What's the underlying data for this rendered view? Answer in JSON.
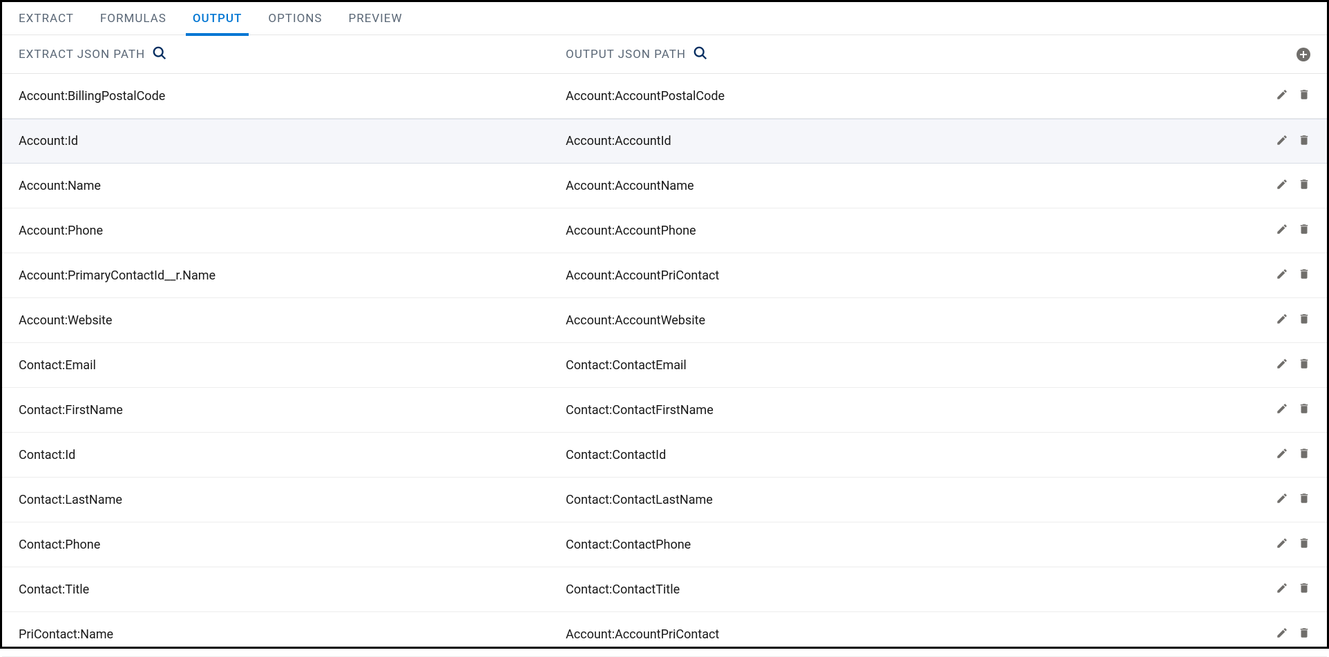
{
  "tabs": [
    {
      "label": "EXTRACT"
    },
    {
      "label": "FORMULAS"
    },
    {
      "label": "OUTPUT"
    },
    {
      "label": "OPTIONS"
    },
    {
      "label": "PREVIEW"
    }
  ],
  "activeTabIndex": 2,
  "headers": {
    "extract": "EXTRACT JSON PATH",
    "output": "OUTPUT JSON PATH"
  },
  "rows": [
    {
      "extract": "Account:BillingPostalCode",
      "output": "Account:AccountPostalCode",
      "highlighted": false
    },
    {
      "extract": "Account:Id",
      "output": "Account:AccountId",
      "highlighted": true
    },
    {
      "extract": "Account:Name",
      "output": "Account:AccountName",
      "highlighted": false
    },
    {
      "extract": "Account:Phone",
      "output": "Account:AccountPhone",
      "highlighted": false
    },
    {
      "extract": "Account:PrimaryContactId__r.Name",
      "output": "Account:AccountPriContact",
      "highlighted": false
    },
    {
      "extract": "Account:Website",
      "output": "Account:AccountWebsite",
      "highlighted": false
    },
    {
      "extract": "Contact:Email",
      "output": "Contact:ContactEmail",
      "highlighted": false
    },
    {
      "extract": "Contact:FirstName",
      "output": "Contact:ContactFirstName",
      "highlighted": false
    },
    {
      "extract": "Contact:Id",
      "output": "Contact:ContactId",
      "highlighted": false
    },
    {
      "extract": "Contact:LastName",
      "output": "Contact:ContactLastName",
      "highlighted": false
    },
    {
      "extract": "Contact:Phone",
      "output": "Contact:ContactPhone",
      "highlighted": false
    },
    {
      "extract": "Contact:Title",
      "output": "Contact:ContactTitle",
      "highlighted": false
    },
    {
      "extract": "PriContact:Name",
      "output": "Account:AccountPriContact",
      "highlighted": false
    }
  ]
}
